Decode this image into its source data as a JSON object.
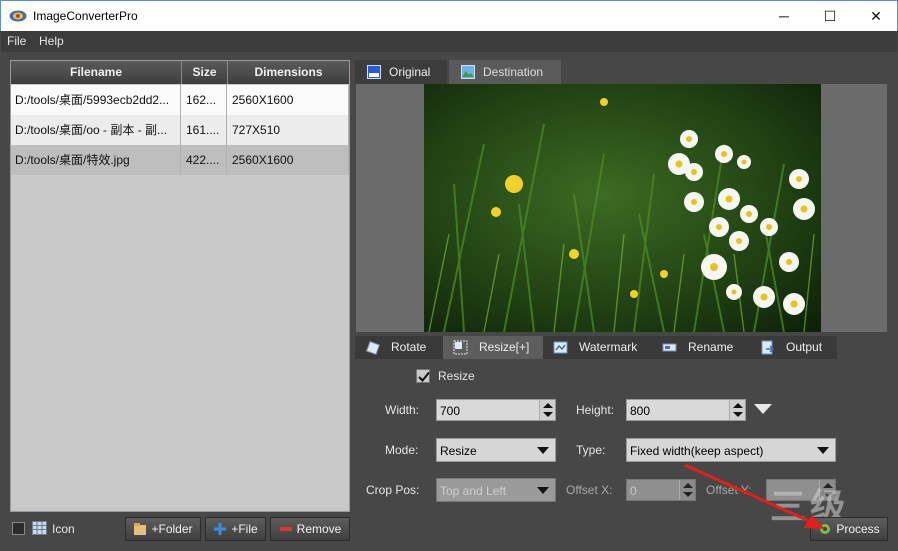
{
  "window": {
    "title": "ImageConverterPro",
    "minimize_glyph": "─",
    "maximize_glyph": "☐",
    "close_glyph": "✕"
  },
  "menu": {
    "file": "File",
    "help": "Help"
  },
  "file_table": {
    "headers": {
      "filename": "Filename",
      "size": "Size",
      "dimensions": "Dimensions"
    },
    "rows": [
      {
        "filename": "D:/tools/桌面/5993ecb2dd2...",
        "size": "162...",
        "dimensions": "2560X1600"
      },
      {
        "filename": "D:/tools/桌面/oo - 副本 - 副...",
        "size": "161....",
        "dimensions": "727X510"
      },
      {
        "filename": "D:/tools/桌面/特效.jpg",
        "size": "422....",
        "dimensions": "2560X1600"
      }
    ]
  },
  "bottom_bar": {
    "icon_label": "Icon",
    "add_folder": "+Folder",
    "add_file": "+File",
    "remove": "Remove",
    "process": "Process"
  },
  "preview_tabs": {
    "original": "Original",
    "destination": "Destination"
  },
  "settings_tabs": {
    "rotate": "Rotate",
    "resize": "Resize[+]",
    "watermark": "Watermark",
    "rename": "Rename",
    "output": "Output"
  },
  "resize": {
    "enable_label": "Resize",
    "width_label": "Width:",
    "width_value": "700",
    "height_label": "Height:",
    "height_value": "800",
    "mode_label": "Mode:",
    "mode_value": "Resize",
    "type_label": "Type:",
    "type_value": "Fixed width(keep aspect)",
    "crop_label": "Crop Pos:",
    "crop_value": "Top and Left",
    "offset_x_label": "Offset X:",
    "offset_x_value": "0",
    "offset_y_label": "Offset Y:",
    "offset_y_value": ""
  },
  "watermark_overlay": "三级",
  "colors": {
    "window_bg": "#474747",
    "arrow": "#e0201c",
    "photo_green": "#2f5a1c"
  }
}
